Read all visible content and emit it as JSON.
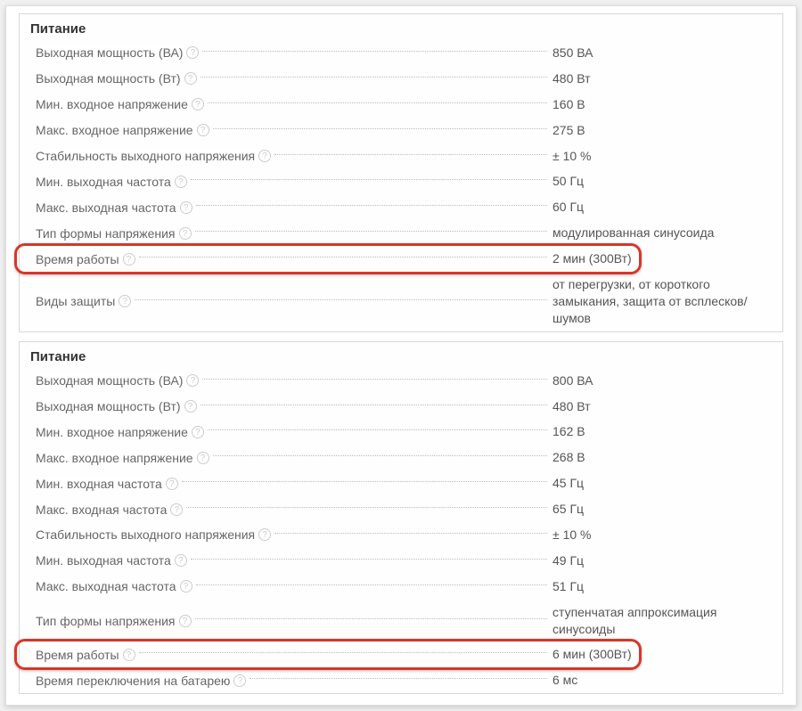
{
  "panels": [
    {
      "title": "Питание",
      "rows": [
        {
          "label": "Выходная мощность (ВА)",
          "help": true,
          "value": "850 ВА",
          "highlight": false
        },
        {
          "label": "Выходная мощность (Вт)",
          "help": true,
          "value": "480 Вт",
          "highlight": false
        },
        {
          "label": "Мин. входное напряжение",
          "help": true,
          "value": "160 В",
          "highlight": false
        },
        {
          "label": "Макс. входное напряжение",
          "help": true,
          "value": "275 В",
          "highlight": false
        },
        {
          "label": "Стабильность выходного напряжения",
          "help": true,
          "value": "± 10 %",
          "highlight": false
        },
        {
          "label": "Мин. выходная частота",
          "help": true,
          "value": "50 Гц",
          "highlight": false
        },
        {
          "label": "Макс. выходная частота",
          "help": true,
          "value": "60 Гц",
          "highlight": false
        },
        {
          "label": "Тип формы напряжения",
          "help": true,
          "value": "модулированная синусоида",
          "highlight": false
        },
        {
          "label": "Время работы",
          "help": true,
          "value": "2 мин (300Вт)",
          "highlight": true
        },
        {
          "label": "Виды защиты",
          "help": true,
          "value": "от перегрузки, от короткого замыкания, защита от всплесков/шумов",
          "highlight": false
        }
      ]
    },
    {
      "title": "Питание",
      "rows": [
        {
          "label": "Выходная мощность (ВА)",
          "help": true,
          "value": "800 ВА",
          "highlight": false
        },
        {
          "label": "Выходная мощность (Вт)",
          "help": true,
          "value": "480 Вт",
          "highlight": false
        },
        {
          "label": "Мин. входное напряжение",
          "help": true,
          "value": "162 В",
          "highlight": false
        },
        {
          "label": "Макс. входное напряжение",
          "help": true,
          "value": "268 В",
          "highlight": false
        },
        {
          "label": "Мин. входная частота",
          "help": true,
          "value": "45 Гц",
          "highlight": false
        },
        {
          "label": "Макс. входная частота",
          "help": true,
          "value": "65 Гц",
          "highlight": false
        },
        {
          "label": "Стабильность выходного напряжения",
          "help": true,
          "value": "± 10 %",
          "highlight": false
        },
        {
          "label": "Мин. выходная частота",
          "help": true,
          "value": "49 Гц",
          "highlight": false
        },
        {
          "label": "Макс. выходная частота",
          "help": true,
          "value": "51 Гц",
          "highlight": false
        },
        {
          "label": "Тип формы напряжения",
          "help": true,
          "value": "ступенчатая аппроксимация синусоиды",
          "highlight": false
        },
        {
          "label": "Время работы",
          "help": true,
          "value": "6 мин (300Вт)",
          "highlight": true
        },
        {
          "label": "Время переключения на батарею",
          "help": true,
          "value": "6 мс",
          "highlight": false
        }
      ]
    }
  ]
}
